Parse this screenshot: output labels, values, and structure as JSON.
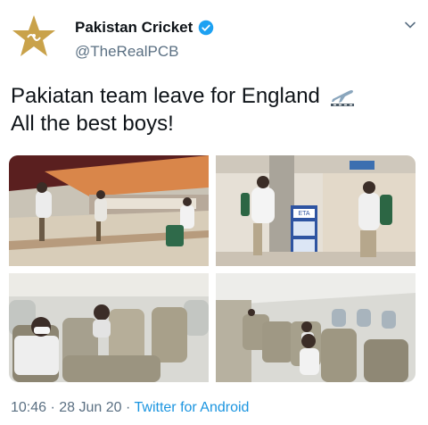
{
  "author": {
    "display_name": "Pakistan Cricket",
    "handle": "@TheRealPCB",
    "verified": true,
    "avatar_icon": "pcb-star-logo-icon"
  },
  "tweet": {
    "line1": "Pakiatan team leave for England",
    "line2": "All the best boys!",
    "emoji_icon": "airplane-departure-icon"
  },
  "media": {
    "photos": [
      {
        "name": "airport-lounge-photo"
      },
      {
        "name": "airport-gate-photo"
      },
      {
        "name": "airplane-cabin-front-photo"
      },
      {
        "name": "airplane-cabin-rear-photo"
      }
    ],
    "badge_text": "ETA"
  },
  "meta": {
    "time": "10:46",
    "separator": "·",
    "date": "28 Jun 20",
    "client": "Twitter for Android"
  },
  "colors": {
    "text": "#0f1419",
    "secondary": "#5b7083",
    "accent": "#1b95e0",
    "logo_gold": "#c9a24a"
  }
}
